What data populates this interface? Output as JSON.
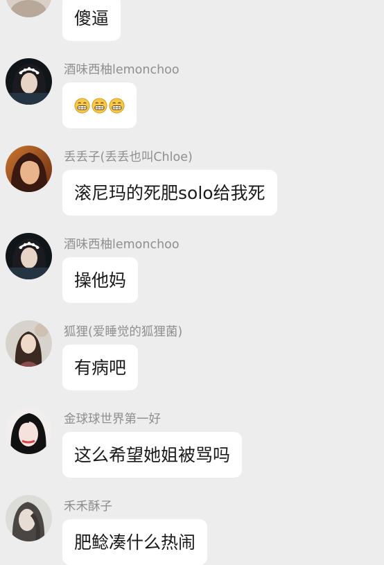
{
  "messages": [
    {
      "sender": "",
      "text": "傻逼"
    },
    {
      "sender": "酒味西柚lemonchoo",
      "emojis": [
        "grinning-face-icon",
        "grinning-face-icon",
        "grinning-face-icon"
      ]
    },
    {
      "sender": "丢丢子(丢丢也叫Chloe)",
      "text": "滚尼玛的死肥solo给我死"
    },
    {
      "sender": "酒味西柚lemonchoo",
      "text": "操他妈"
    },
    {
      "sender": "狐狸(爱睡觉的狐狸菌)",
      "text": "有病吧"
    },
    {
      "sender": "金球球世界第一好",
      "text": "这么希望她姐被骂吗"
    },
    {
      "sender": "禾禾酥子",
      "text": "肥鲶凑什么热闹"
    }
  ],
  "colors": {
    "background": "#ededed",
    "bubble": "#ffffff",
    "sender_name": "#8f8f8f",
    "message_text": "#1a1a1a",
    "emoji_face": "#f7c94a"
  }
}
